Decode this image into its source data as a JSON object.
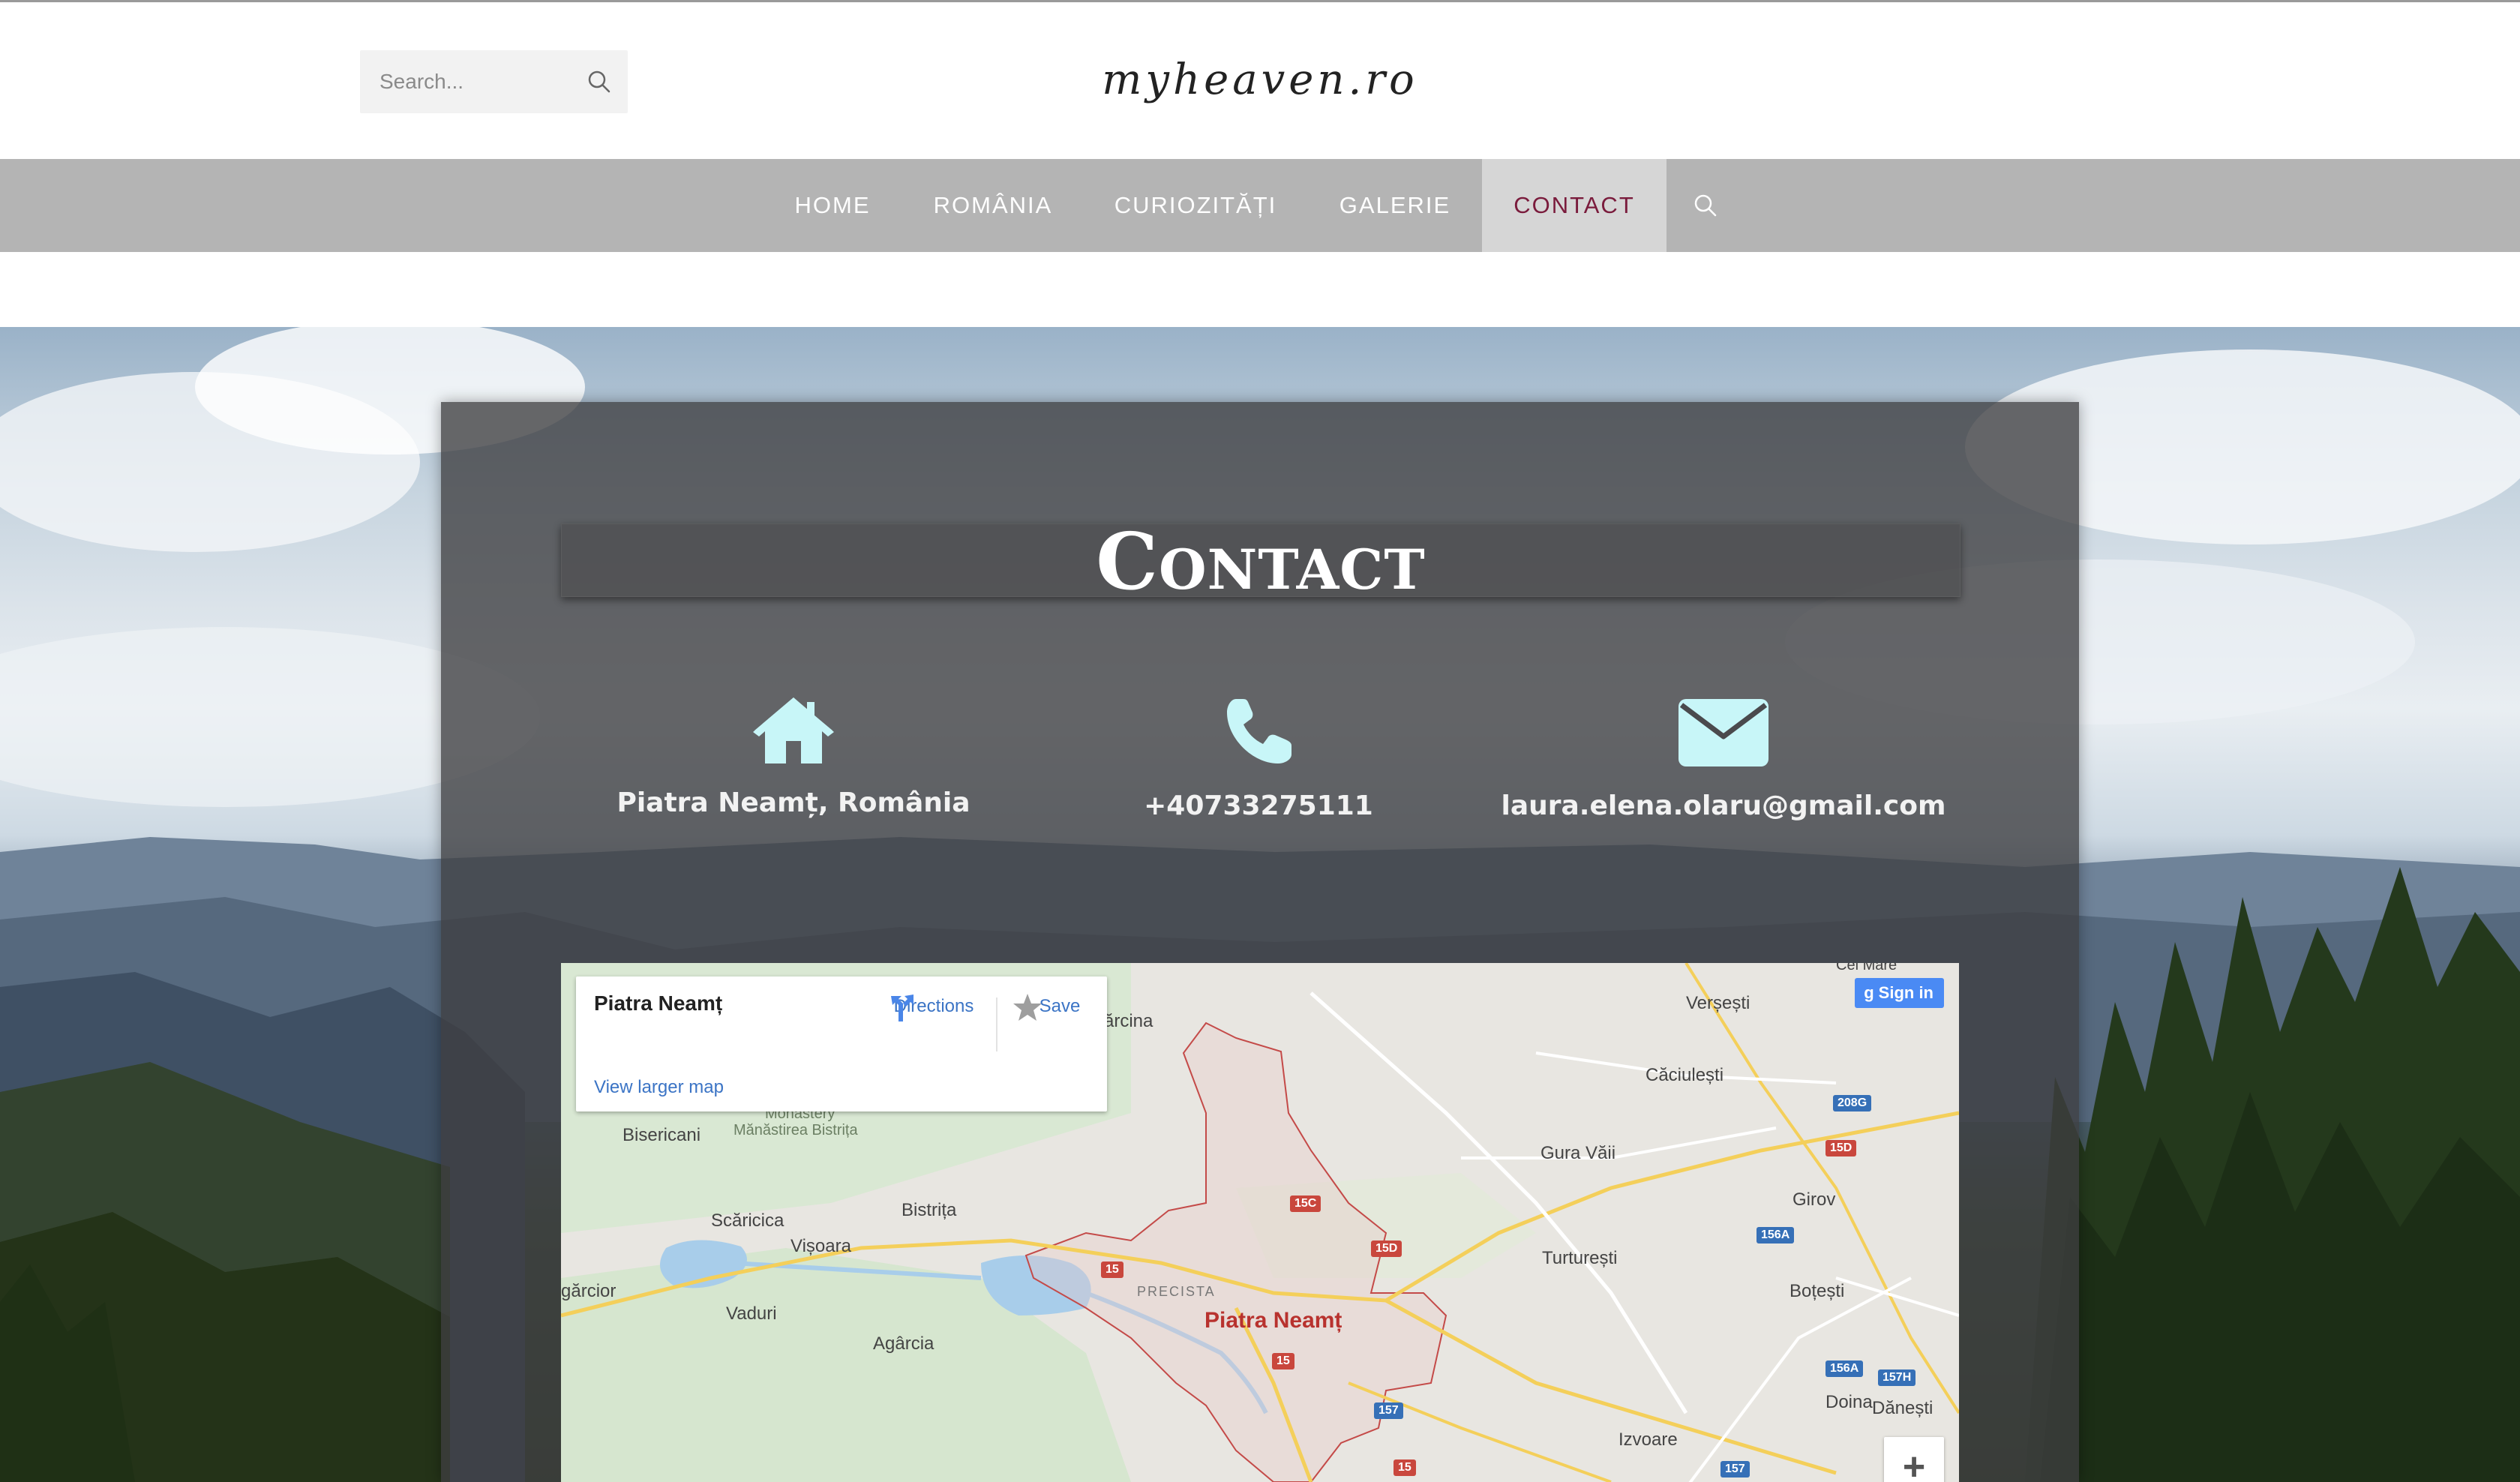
{
  "site": {
    "brand": "myheaven.ro",
    "search": {
      "placeholder": "Search..."
    }
  },
  "nav": {
    "items": [
      {
        "label": "HOME",
        "active": false
      },
      {
        "label": "ROMÂNIA",
        "active": false
      },
      {
        "label": "CURIOZITĂȚI",
        "active": false
      },
      {
        "label": "GALERIE",
        "active": false
      },
      {
        "label": "CONTACT",
        "active": true
      }
    ],
    "search_icon": "search-icon"
  },
  "contact": {
    "title": "Contact",
    "items": [
      {
        "icon": "home-icon",
        "text": "Piatra Neamț, România"
      },
      {
        "icon": "phone-icon",
        "text": "+40733275111"
      },
      {
        "icon": "envelope-icon",
        "text": "laura.elena.olaru@gmail.com"
      }
    ],
    "icon_color": "#c8f6f8"
  },
  "map": {
    "card": {
      "place": "Piatra Neamț",
      "directions": "Directions",
      "save": "Save",
      "larger_map": "View larger map"
    },
    "signin": "Sign in",
    "zoom_in": "+",
    "places": [
      {
        "name": "Verșești"
      },
      {
        "name": "Căciulești"
      },
      {
        "name": "Gura Văii"
      },
      {
        "name": "Girov"
      },
      {
        "name": "Turturești"
      },
      {
        "name": "Boțești"
      },
      {
        "name": "Doina"
      },
      {
        "name": "Dănești"
      },
      {
        "name": "Izvoare"
      },
      {
        "name": "Bisericani"
      },
      {
        "name": "Mănăstirea Bistrița"
      },
      {
        "name": "Monastery"
      },
      {
        "name": "Scăricica"
      },
      {
        "name": "Bistrița"
      },
      {
        "name": "Vișoara"
      },
      {
        "name": "gărcior"
      },
      {
        "name": "Vaduri"
      },
      {
        "name": "Agârcia"
      },
      {
        "name": "PRECISTA"
      },
      {
        "name": "Piatra Neamț"
      },
      {
        "name": "ărcina"
      },
      {
        "name": "Cel Mare"
      }
    ],
    "roads": [
      "15",
      "15C",
      "15D",
      "15",
      "157",
      "15",
      "157",
      "156A",
      "156A",
      "157H",
      "208G",
      "15D"
    ]
  }
}
